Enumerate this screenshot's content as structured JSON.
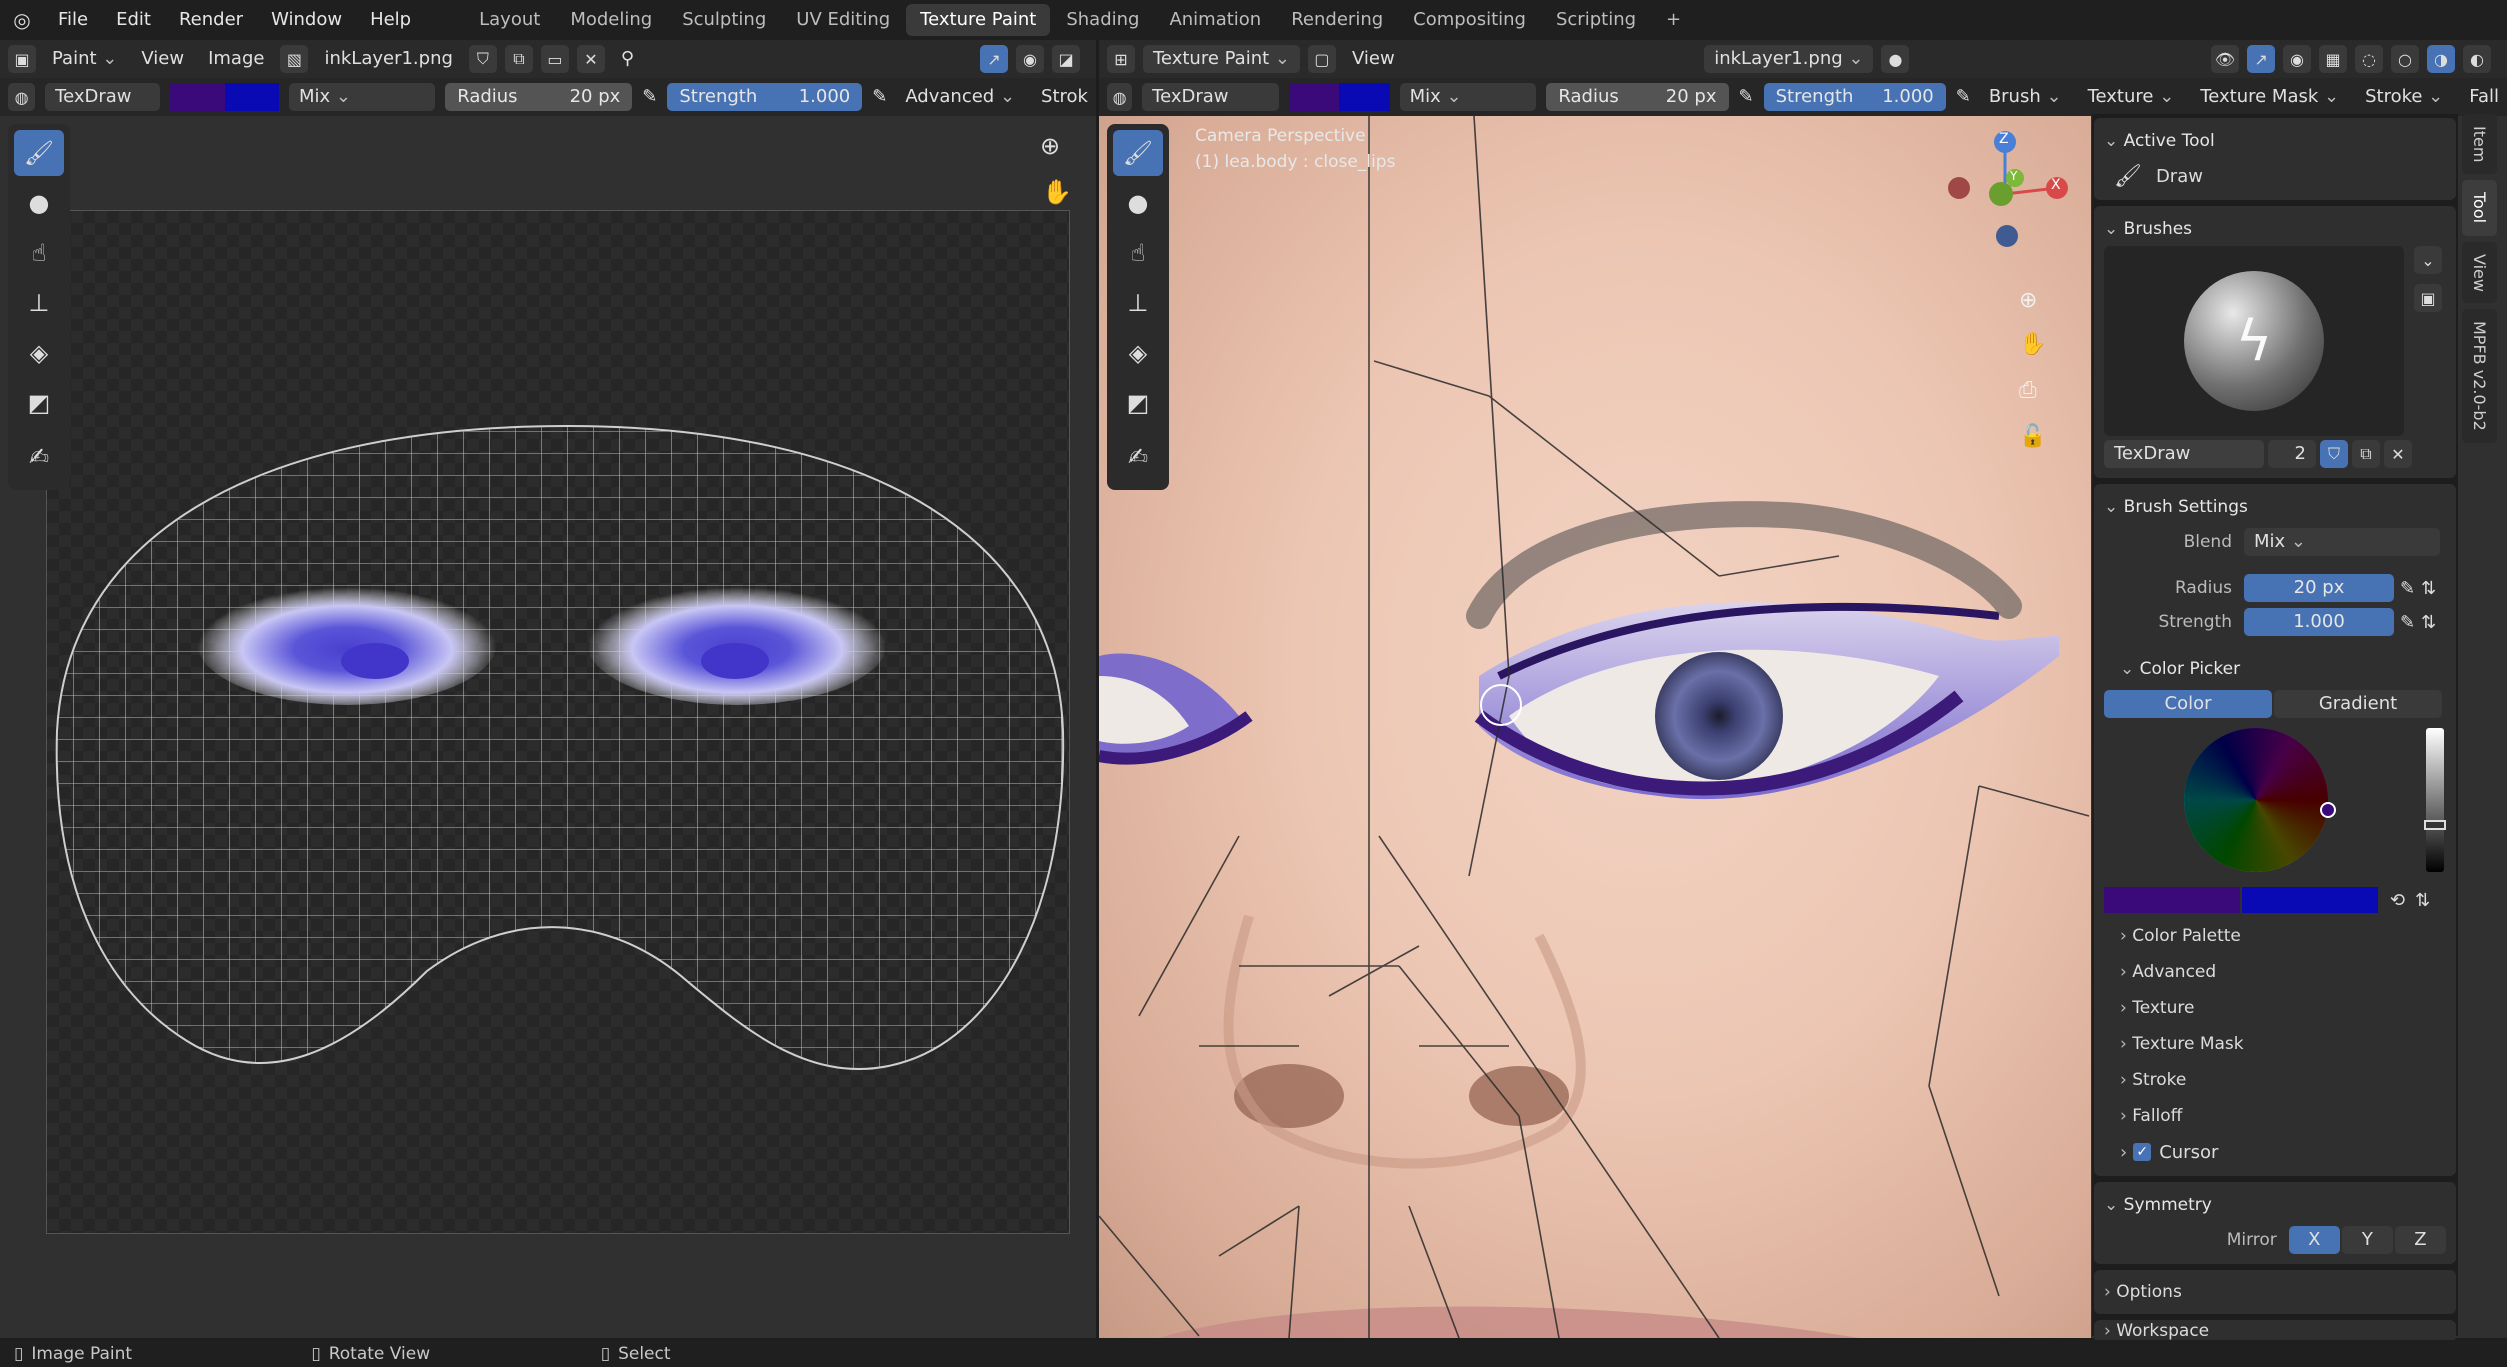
{
  "menus": [
    "File",
    "Edit",
    "Render",
    "Window",
    "Help"
  ],
  "workspaces": [
    "Layout",
    "Modeling",
    "Sculpting",
    "UV Editing",
    "Texture Paint",
    "Shading",
    "Animation",
    "Rendering",
    "Compositing",
    "Scripting"
  ],
  "active_workspace": "Texture Paint",
  "left_editor": {
    "mode": "Paint",
    "menu_view": "View",
    "menu_image": "Image",
    "image_name": "inkLayer1.png",
    "tool_settings": {
      "brush": "TexDraw",
      "blend": "Mix",
      "radius_label": "Radius",
      "radius_value": "20 px",
      "strength_label": "Strength",
      "strength_value": "1.000",
      "advanced": "Advanced",
      "stroke": "Strok"
    }
  },
  "right_editor": {
    "mode": "Texture Paint",
    "menu_view": "View",
    "image_name": "inkLayer1.png",
    "overlay_text_1": "Camera Perspective",
    "overlay_text_2": "(1) lea.body : close_lips",
    "tool_settings": {
      "brush": "TexDraw",
      "blend": "Mix",
      "radius_label": "Radius",
      "radius_value": "20 px",
      "strength_label": "Strength",
      "strength_value": "1.000",
      "brush_menu": "Brush",
      "texture_menu": "Texture",
      "texture_mask_menu": "Texture Mask",
      "stroke_menu": "Stroke",
      "falloff_menu": "Fall"
    },
    "gizmo": {
      "z": "Z",
      "y": "Y",
      "x": "X"
    }
  },
  "sidebar": {
    "active_tool_title": "Active Tool",
    "active_tool_name": "Draw",
    "brushes_title": "Brushes",
    "brush_name": "TexDraw",
    "brush_users": "2",
    "brush_settings_title": "Brush Settings",
    "blend_label": "Blend",
    "blend_value": "Mix",
    "radius_label": "Radius",
    "radius_value": "20 px",
    "strength_label": "Strength",
    "strength_value": "1.000",
    "color_picker_title": "Color Picker",
    "color_tab": "Color",
    "gradient_tab": "Gradient",
    "subpanels": [
      "Color Palette",
      "Advanced",
      "Texture",
      "Texture Mask",
      "Stroke",
      "Falloff"
    ],
    "cursor_label": "Cursor",
    "symmetry_title": "Symmetry",
    "mirror_label": "Mirror",
    "mirror_axes": [
      "X",
      "Y",
      "Z"
    ],
    "options_title": "Options",
    "workspace_title": "Workspace",
    "tabs": [
      "Item",
      "Tool",
      "View",
      "MPFB v2.0-b2"
    ],
    "active_tab": "Tool"
  },
  "status_bar": {
    "item1": "Image Paint",
    "item2": "Rotate View",
    "item3": "Select"
  },
  "colors": {
    "primary": "#3a0a7a",
    "secondary": "#0a0ab4",
    "accent": "#4772b3"
  }
}
